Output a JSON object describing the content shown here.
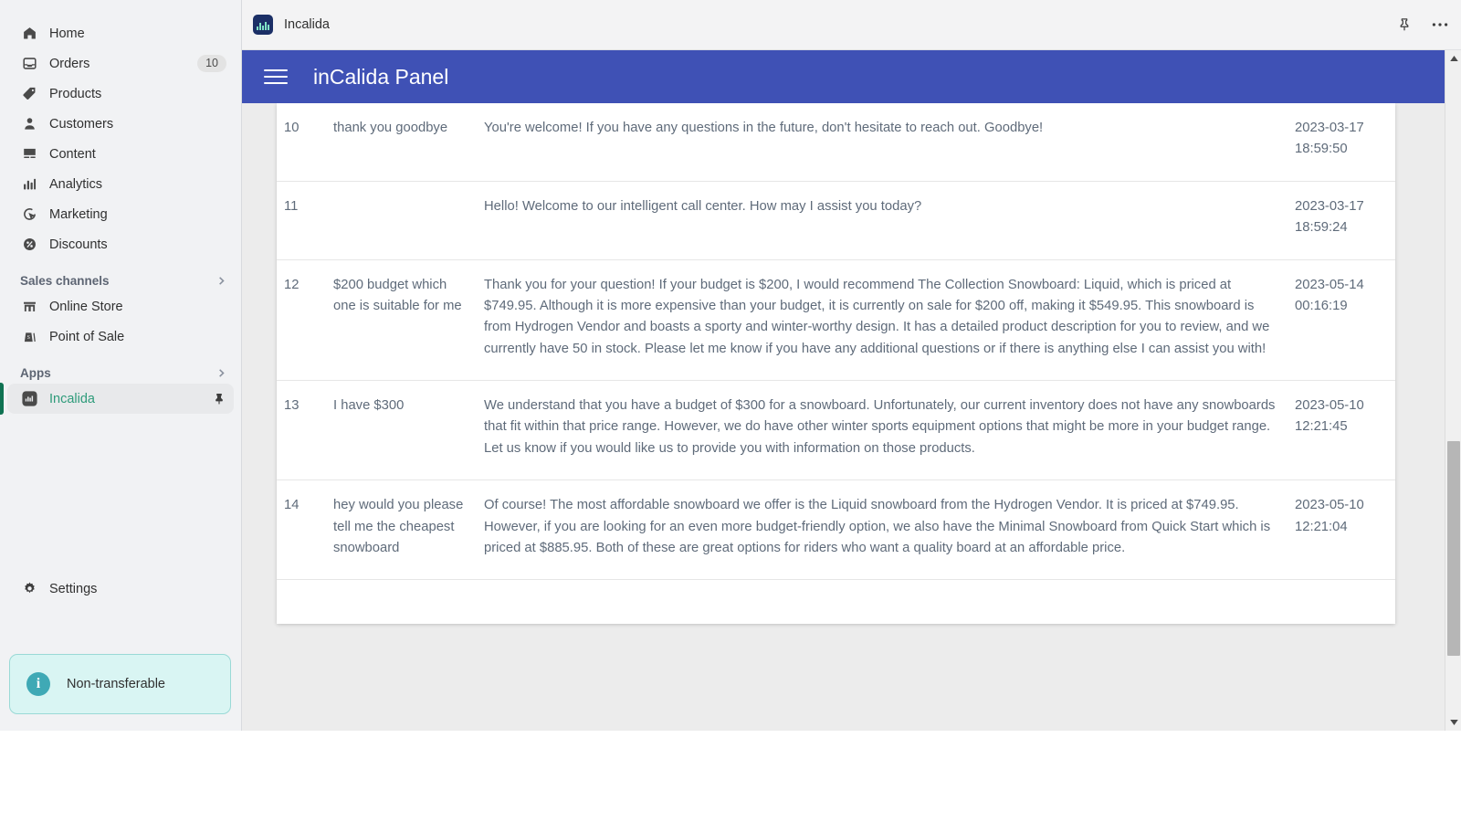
{
  "sidebar": {
    "primary_items": [
      {
        "label": "Home",
        "icon": "home-icon",
        "badge": ""
      },
      {
        "label": "Orders",
        "icon": "orders-icon",
        "badge": "10"
      },
      {
        "label": "Products",
        "icon": "products-icon",
        "badge": ""
      },
      {
        "label": "Customers",
        "icon": "customers-icon",
        "badge": ""
      },
      {
        "label": "Content",
        "icon": "content-icon",
        "badge": ""
      },
      {
        "label": "Analytics",
        "icon": "analytics-icon",
        "badge": ""
      },
      {
        "label": "Marketing",
        "icon": "marketing-icon",
        "badge": ""
      },
      {
        "label": "Discounts",
        "icon": "discounts-icon",
        "badge": ""
      }
    ],
    "sales_channels": {
      "title": "Sales channels",
      "chevron": "chevron-right-icon",
      "items": [
        {
          "label": "Online Store",
          "icon": "storefront-icon"
        },
        {
          "label": "Point of Sale",
          "icon": "point-of-sale-icon"
        }
      ]
    },
    "apps": {
      "title": "Apps",
      "chevron": "chevron-right-icon",
      "items": [
        {
          "label": "Incalida",
          "icon": "incalida-app-icon",
          "pin": "pin-icon",
          "active": true
        }
      ]
    },
    "settings": {
      "label": "Settings",
      "icon": "gear-icon"
    },
    "notice": {
      "label": "Non-transferable",
      "icon": "info-icon"
    },
    "accent_color": "#2e9b7a",
    "active_bar_color": "#0f7252"
  },
  "app_frame": {
    "title": "Incalida",
    "favicon": "incalida-favicon",
    "pin_icon": "pin-icon",
    "more_icon": "more-horizontal-icon"
  },
  "panel_bar": {
    "menu_icon": "hamburger-menu-icon",
    "title": "inCalida Panel",
    "color": "#3f51b5"
  },
  "table": {
    "rows": [
      {
        "id": "10",
        "question": "thank you goodbye",
        "answer": "You're welcome! If you have any questions in the future, don't hesitate to reach out. Goodbye!",
        "date": "2023-03-17 18:59:50"
      },
      {
        "id": "11",
        "question": "",
        "answer": "Hello! Welcome to our intelligent call center. How may I assist you today?",
        "date": "2023-03-17 18:59:24"
      },
      {
        "id": "12",
        "question": "$200 budget which one is suitable for me",
        "answer": "Thank you for your question! If your budget is $200, I would recommend The Collection Snowboard: Liquid, which is priced at $749.95. Although it is more expensive than your budget, it is currently on sale for $200 off, making it $549.95. This snowboard is from Hydrogen Vendor and boasts a sporty and winter-worthy design. It has a detailed product description for you to review, and we currently have 50 in stock. Please let me know if you have any additional questions or if there is anything else I can assist you with!",
        "date": "2023-05-14 00:16:19"
      },
      {
        "id": "13",
        "question": "I have $300",
        "answer": "We understand that you have a budget of $300 for a snowboard. Unfortunately, our current inventory does not have any snowboards that fit within that price range. However, we do have other winter sports equipment options that might be more in your budget range. Let us know if you would like us to provide you with information on those products.",
        "date": "2023-05-10 12:21:45"
      },
      {
        "id": "14",
        "question": "hey would you please tell me the cheapest snowboard",
        "answer": "Of course! The most affordable snowboard we offer is the Liquid snowboard from the Hydrogen Vendor. It is priced at $749.95. However, if you are looking for an even more budget-friendly option, we also have the Minimal Snowboard from Quick Start which is priced at $885.95. Both of these are great options for riders who want a quality board at an affordable price.",
        "date": "2023-05-10 12:21:04"
      }
    ]
  },
  "scrollbar": {
    "up_arrow": "scroll-up-arrow-icon",
    "down_arrow": "scroll-down-arrow-icon",
    "thumb": "scroll-thumb"
  }
}
